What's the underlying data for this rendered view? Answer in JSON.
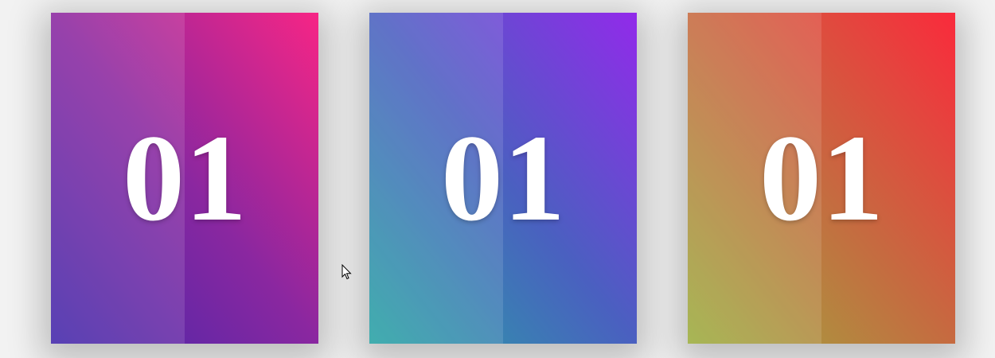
{
  "cards": [
    {
      "label": "01",
      "gradient": [
        "#4127aa",
        "#f72585"
      ]
    },
    {
      "label": "01",
      "gradient": [
        "#27a3a3",
        "#922aea"
      ]
    },
    {
      "label": "01",
      "gradient": [
        "#9bad3e",
        "#fa2a3c"
      ]
    }
  ]
}
